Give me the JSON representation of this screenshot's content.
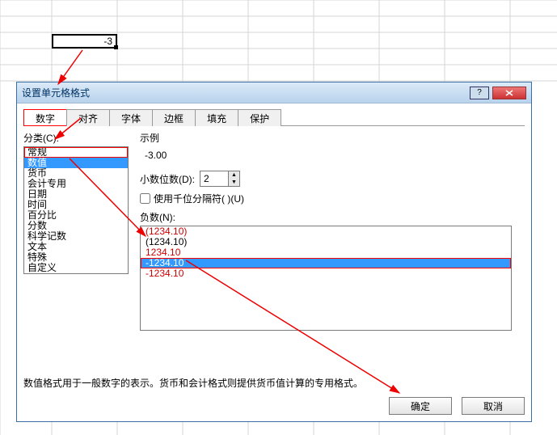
{
  "doc": {
    "cell_value": "-3"
  },
  "dialog": {
    "title": "设置单元格格式",
    "tabs": {
      "number": "数字",
      "align": "对齐",
      "font": "字体",
      "border": "边框",
      "fill": "填充",
      "protect": "保护"
    },
    "category_label": "分类(C):",
    "categories": [
      "常规",
      "数值",
      "货币",
      "会计专用",
      "日期",
      "时间",
      "百分比",
      "分数",
      "科学记数",
      "文本",
      "特殊",
      "自定义"
    ],
    "selected_category_index": 1,
    "sample_label": "示例",
    "sample_value": "-3.00",
    "decimal_label": "小数位数(D):",
    "decimal_value": "2",
    "thousand_label": "使用千位分隔符( )(U)",
    "negative_label": "负数(N):",
    "negative_items": [
      {
        "text": "(1234.10)",
        "color": "red"
      },
      {
        "text": "(1234.10)",
        "color": "black"
      },
      {
        "text": "1234.10",
        "color": "red"
      },
      {
        "text": "-1234.10",
        "color": "black",
        "selected": true,
        "boxed": true
      },
      {
        "text": "-1234.10",
        "color": "red"
      }
    ],
    "description": "数值格式用于一般数字的表示。货币和会计格式则提供货币值计算的专用格式。",
    "ok": "确定",
    "cancel": "取消"
  }
}
